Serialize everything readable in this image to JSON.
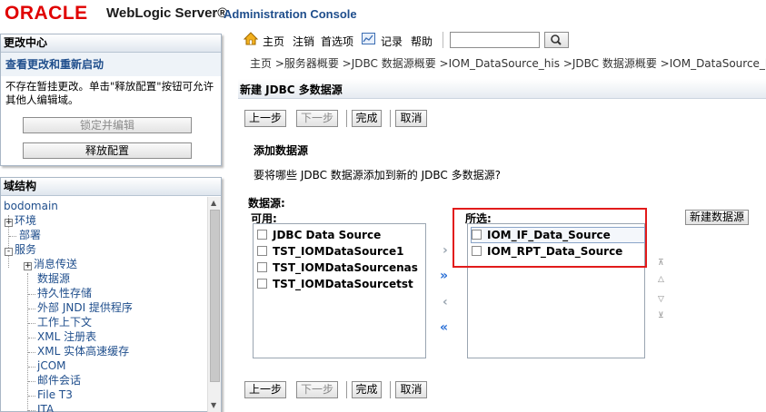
{
  "header": {
    "logo_oracle": "ORACLE",
    "product": "WebLogic Server®",
    "subtitle": "Administration Console"
  },
  "change_center": {
    "title": "更改中心",
    "link": "查看更改和重新启动",
    "description": "不存在暂挂更改。单击\"释放配置\"按钮可允许其他人编辑域。",
    "lock_button": "锁定并编辑",
    "release_button": "释放配置"
  },
  "domain_structure": {
    "title": "域结构",
    "root": "bodomain",
    "items": {
      "env": "环境",
      "deploy": "部署",
      "services": "服务",
      "messaging": "消息传送",
      "datasource": "数据源",
      "persistent": "持久性存储",
      "jndi": "外部 JNDI 提供程序",
      "workctx": "工作上下文",
      "xmlreg": "XML 注册表",
      "xmlcache": "XML 实体高速缓存",
      "jcom": "jCOM",
      "mail": "邮件会话",
      "filet3": "File T3",
      "jta": "JTA"
    },
    "expanders": {
      "plus": "+",
      "minus": "-"
    }
  },
  "toolbar": {
    "home": "主页",
    "logout": "注销",
    "preferences": "首选项",
    "record": "记录",
    "help": "帮助",
    "search_value": ""
  },
  "breadcrumb": "主页 >服务器概要 >JDBC 数据源概要 >IOM_DataSource_his >JDBC 数据源概要 >IOM_DataSource_his >",
  "page": {
    "title": "新建 JDBC 多数据源",
    "buttons": {
      "back": "上一步",
      "next": "下一步",
      "finish": "完成",
      "cancel": "取消"
    },
    "section_title": "添加数据源",
    "question": "要将哪些 JDBC 数据源添加到新的 JDBC 多数据源?",
    "datasource_label": "数据源:",
    "available_label": "可用:",
    "chosen_label": "所选:",
    "new_datasource_button": "新建数据源",
    "available": [
      "JDBC Data Source",
      "TST_IOMDataSource1",
      "TST_IOMDataSourcenas",
      "TST_IOMDataSourcetst"
    ],
    "chosen": [
      "IOM_IF_Data_Source",
      "IOM_RPT_Data_Source"
    ],
    "arrows": {
      "move_right": "›",
      "move_all_right": "»",
      "move_left": "‹",
      "move_all_left": "«",
      "top": "⊼",
      "up": "△",
      "down": "▽",
      "bottom": "⊻"
    }
  },
  "colors": {
    "oracle_red": "#e00000",
    "link_blue": "#1f4e8c",
    "highlight_red": "#e21b1b",
    "arrow_blue": "#2a6fd6"
  }
}
